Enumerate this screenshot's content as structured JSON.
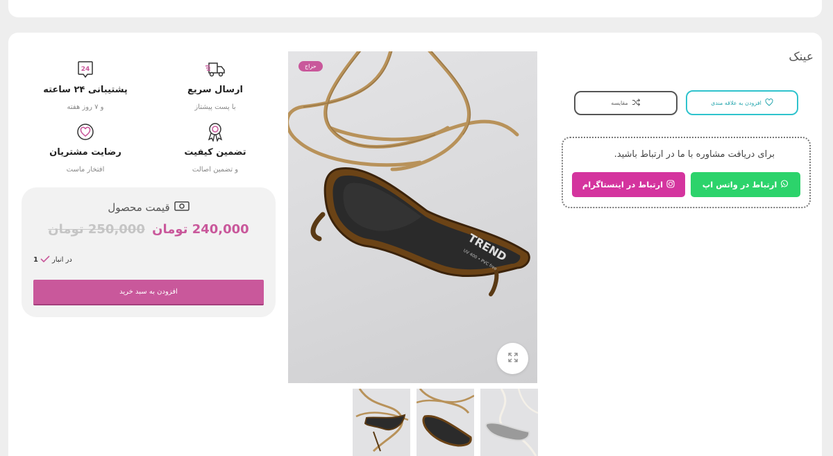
{
  "product": {
    "title": "عینک",
    "tag": "حراج"
  },
  "actions": {
    "wishlist_label": "افزودن به علاقه مندی",
    "compare_label": "مقایسه"
  },
  "consult": {
    "text": "برای دریافت مشاوره با ما در ارتباط باشید.",
    "whatsapp_label": "ارتباط در واتس اپ",
    "instagram_label": "ارتباط در اینستاگرام"
  },
  "features": [
    {
      "title": "پشتیبانی ۲۴ ساعته",
      "subtitle": "و ۷ روز هفته",
      "icon": "support-24-icon"
    },
    {
      "title": "ارسال سریع",
      "subtitle": "با پست پیشتاز",
      "icon": "delivery-truck-icon"
    },
    {
      "title": "رضایت مشتریان",
      "subtitle": "افتخار ماست",
      "icon": "heart-badge-icon"
    },
    {
      "title": "تضمین کیفیت",
      "subtitle": "و تضمین اصالت",
      "icon": "quality-medal-icon"
    }
  ],
  "support_badge_text": "24",
  "price": {
    "label": "قیمت محصول",
    "old": "250,000 تومان",
    "new": "240,000 تومان"
  },
  "stock": {
    "count": "1",
    "label": "در انبار"
  },
  "cart": {
    "button_label": "افزودن به سبد خرید"
  },
  "lens_print": {
    "brand": "TREND",
    "spec": "UV 400 • PVC free"
  },
  "colors": {
    "brand_pink": "#c9589b",
    "whatsapp_green": "#2cd36b",
    "instagram_magenta": "#d4349e",
    "wishlist_cyan": "#2fc3cd"
  }
}
